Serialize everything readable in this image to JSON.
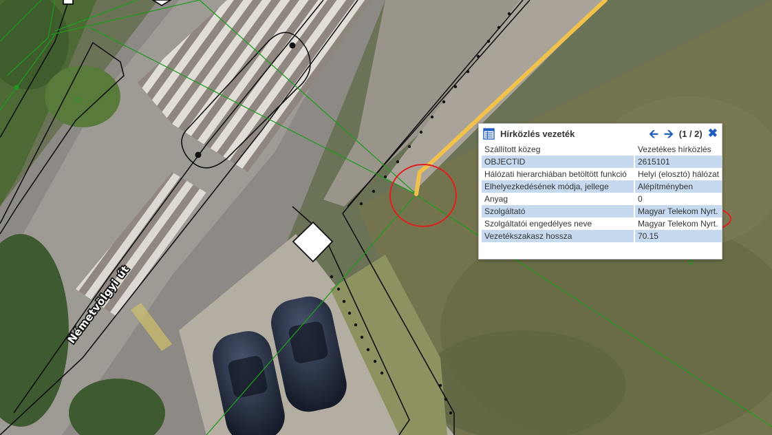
{
  "map": {
    "street_label": "Németvölgyi út",
    "colors": {
      "network_line": "#1f9a1f",
      "highlight_cable": "#f0c14b",
      "annotation_circle": "#e02020",
      "outline": "#111111"
    }
  },
  "popup": {
    "icon": "layer-table-icon",
    "title": "Hírközlés vezeték",
    "pager": "(1 / 2)",
    "prev_icon": "arrow-left-icon",
    "next_icon": "arrow-right-icon",
    "close_icon": "close-icon",
    "attributes": [
      {
        "key": "Szállított közeg",
        "value": "Vezetékes hírközlés"
      },
      {
        "key": "OBJECTID",
        "value": "2615101"
      },
      {
        "key": "Hálózati hierarchiában betöltött funkció",
        "value": "Helyi (elosztó) hálózat"
      },
      {
        "key": "Elhelyezkedésének módja, jellege",
        "value": "Alépítményben"
      },
      {
        "key": "Anyag",
        "value": "0"
      },
      {
        "key": "Szolgáltató",
        "value": "Magyar Telekom Nyrt."
      },
      {
        "key": "Szolgáltatói engedélyes neve",
        "value": "Magyar Telekom Nyrt."
      },
      {
        "key": "Vezetékszakasz hossza",
        "value": "70.15"
      }
    ]
  }
}
